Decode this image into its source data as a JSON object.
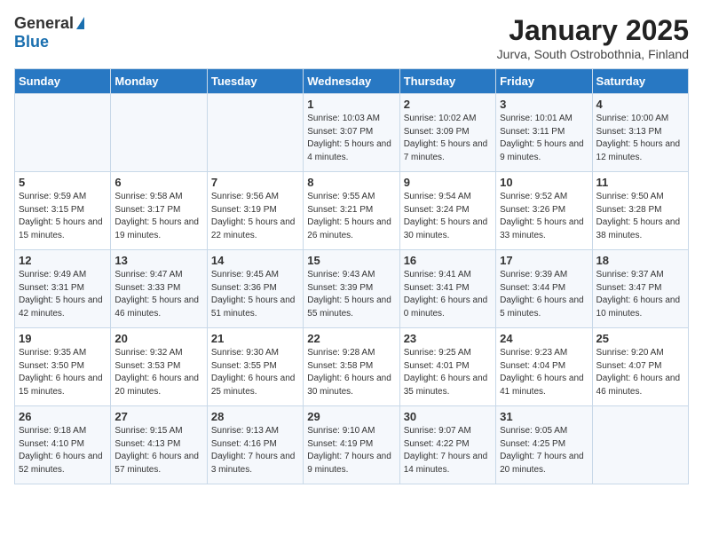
{
  "header": {
    "logo_general": "General",
    "logo_blue": "Blue",
    "month_title": "January 2025",
    "subtitle": "Jurva, South Ostrobothnia, Finland"
  },
  "days_of_week": [
    "Sunday",
    "Monday",
    "Tuesday",
    "Wednesday",
    "Thursday",
    "Friday",
    "Saturday"
  ],
  "weeks": [
    [
      {
        "day": "",
        "info": ""
      },
      {
        "day": "",
        "info": ""
      },
      {
        "day": "",
        "info": ""
      },
      {
        "day": "1",
        "info": "Sunrise: 10:03 AM\nSunset: 3:07 PM\nDaylight: 5 hours and 4 minutes."
      },
      {
        "day": "2",
        "info": "Sunrise: 10:02 AM\nSunset: 3:09 PM\nDaylight: 5 hours and 7 minutes."
      },
      {
        "day": "3",
        "info": "Sunrise: 10:01 AM\nSunset: 3:11 PM\nDaylight: 5 hours and 9 minutes."
      },
      {
        "day": "4",
        "info": "Sunrise: 10:00 AM\nSunset: 3:13 PM\nDaylight: 5 hours and 12 minutes."
      }
    ],
    [
      {
        "day": "5",
        "info": "Sunrise: 9:59 AM\nSunset: 3:15 PM\nDaylight: 5 hours and 15 minutes."
      },
      {
        "day": "6",
        "info": "Sunrise: 9:58 AM\nSunset: 3:17 PM\nDaylight: 5 hours and 19 minutes."
      },
      {
        "day": "7",
        "info": "Sunrise: 9:56 AM\nSunset: 3:19 PM\nDaylight: 5 hours and 22 minutes."
      },
      {
        "day": "8",
        "info": "Sunrise: 9:55 AM\nSunset: 3:21 PM\nDaylight: 5 hours and 26 minutes."
      },
      {
        "day": "9",
        "info": "Sunrise: 9:54 AM\nSunset: 3:24 PM\nDaylight: 5 hours and 30 minutes."
      },
      {
        "day": "10",
        "info": "Sunrise: 9:52 AM\nSunset: 3:26 PM\nDaylight: 5 hours and 33 minutes."
      },
      {
        "day": "11",
        "info": "Sunrise: 9:50 AM\nSunset: 3:28 PM\nDaylight: 5 hours and 38 minutes."
      }
    ],
    [
      {
        "day": "12",
        "info": "Sunrise: 9:49 AM\nSunset: 3:31 PM\nDaylight: 5 hours and 42 minutes."
      },
      {
        "day": "13",
        "info": "Sunrise: 9:47 AM\nSunset: 3:33 PM\nDaylight: 5 hours and 46 minutes."
      },
      {
        "day": "14",
        "info": "Sunrise: 9:45 AM\nSunset: 3:36 PM\nDaylight: 5 hours and 51 minutes."
      },
      {
        "day": "15",
        "info": "Sunrise: 9:43 AM\nSunset: 3:39 PM\nDaylight: 5 hours and 55 minutes."
      },
      {
        "day": "16",
        "info": "Sunrise: 9:41 AM\nSunset: 3:41 PM\nDaylight: 6 hours and 0 minutes."
      },
      {
        "day": "17",
        "info": "Sunrise: 9:39 AM\nSunset: 3:44 PM\nDaylight: 6 hours and 5 minutes."
      },
      {
        "day": "18",
        "info": "Sunrise: 9:37 AM\nSunset: 3:47 PM\nDaylight: 6 hours and 10 minutes."
      }
    ],
    [
      {
        "day": "19",
        "info": "Sunrise: 9:35 AM\nSunset: 3:50 PM\nDaylight: 6 hours and 15 minutes."
      },
      {
        "day": "20",
        "info": "Sunrise: 9:32 AM\nSunset: 3:53 PM\nDaylight: 6 hours and 20 minutes."
      },
      {
        "day": "21",
        "info": "Sunrise: 9:30 AM\nSunset: 3:55 PM\nDaylight: 6 hours and 25 minutes."
      },
      {
        "day": "22",
        "info": "Sunrise: 9:28 AM\nSunset: 3:58 PM\nDaylight: 6 hours and 30 minutes."
      },
      {
        "day": "23",
        "info": "Sunrise: 9:25 AM\nSunset: 4:01 PM\nDaylight: 6 hours and 35 minutes."
      },
      {
        "day": "24",
        "info": "Sunrise: 9:23 AM\nSunset: 4:04 PM\nDaylight: 6 hours and 41 minutes."
      },
      {
        "day": "25",
        "info": "Sunrise: 9:20 AM\nSunset: 4:07 PM\nDaylight: 6 hours and 46 minutes."
      }
    ],
    [
      {
        "day": "26",
        "info": "Sunrise: 9:18 AM\nSunset: 4:10 PM\nDaylight: 6 hours and 52 minutes."
      },
      {
        "day": "27",
        "info": "Sunrise: 9:15 AM\nSunset: 4:13 PM\nDaylight: 6 hours and 57 minutes."
      },
      {
        "day": "28",
        "info": "Sunrise: 9:13 AM\nSunset: 4:16 PM\nDaylight: 7 hours and 3 minutes."
      },
      {
        "day": "29",
        "info": "Sunrise: 9:10 AM\nSunset: 4:19 PM\nDaylight: 7 hours and 9 minutes."
      },
      {
        "day": "30",
        "info": "Sunrise: 9:07 AM\nSunset: 4:22 PM\nDaylight: 7 hours and 14 minutes."
      },
      {
        "day": "31",
        "info": "Sunrise: 9:05 AM\nSunset: 4:25 PM\nDaylight: 7 hours and 20 minutes."
      },
      {
        "day": "",
        "info": ""
      }
    ]
  ]
}
